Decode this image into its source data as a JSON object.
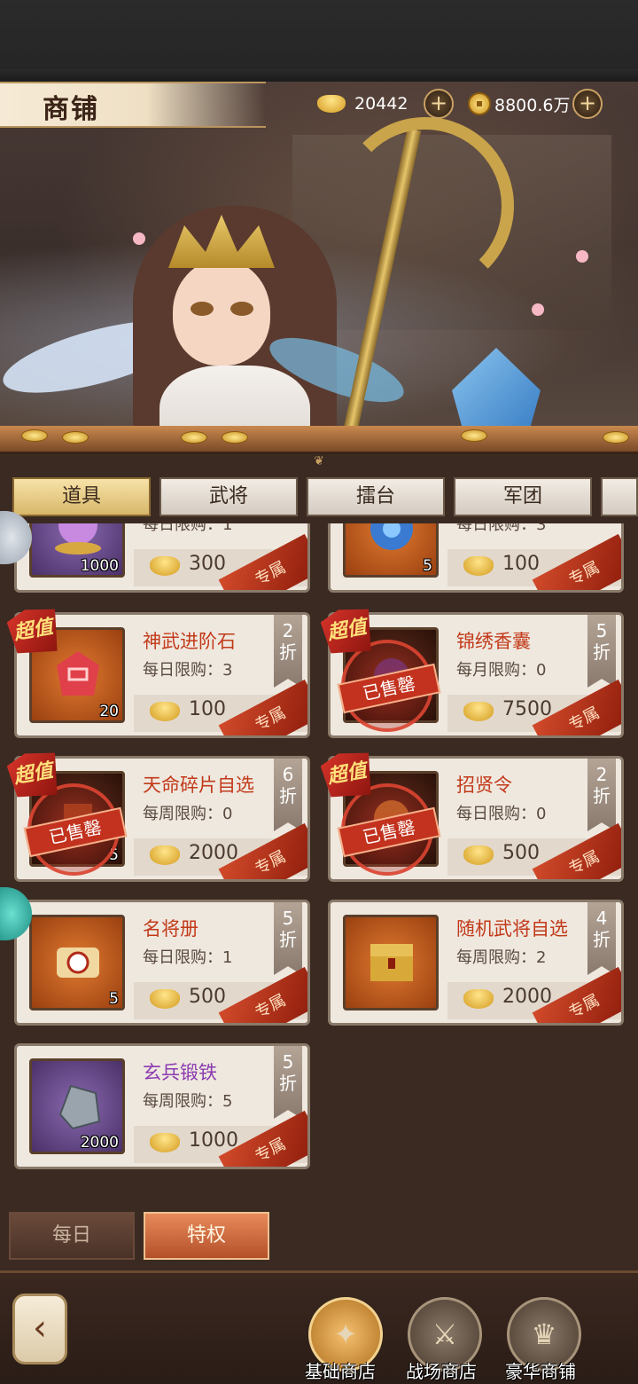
{
  "header": {
    "title": "商铺",
    "ingot_amount": "20442",
    "coin_amount": "8800.6万"
  },
  "tabs": [
    "道具",
    "武将",
    "擂台",
    "军团"
  ],
  "cards_partial": [
    {
      "qty": "1000",
      "limit": "每日限购：1",
      "price": "300",
      "exclusive": "专属"
    },
    {
      "qty": "5",
      "limit": "每日限购：3",
      "price": "100",
      "exclusive": "专属"
    }
  ],
  "cards": [
    {
      "name": "神武进阶石",
      "limit": "每日限购：3",
      "price": "100",
      "discount": "2折",
      "qty": "20",
      "super": "超值",
      "sold": "",
      "exclusive": "专属"
    },
    {
      "name": "锦绣香囊",
      "limit": "每月限购：0",
      "price": "7500",
      "discount": "5折",
      "qty": "",
      "super": "超值",
      "sold": "已售罄",
      "exclusive": "专属"
    },
    {
      "name": "天命碎片自选",
      "limit": "每周限购：0",
      "price": "2000",
      "discount": "6折",
      "qty": "5",
      "super": "超值",
      "sold": "已售罄",
      "exclusive": "专属"
    },
    {
      "name": "招贤令",
      "limit": "每日限购：0",
      "price": "500",
      "discount": "2折",
      "qty": "",
      "super": "超值",
      "sold": "已售罄",
      "exclusive": "专属"
    },
    {
      "name": "名将册",
      "limit": "每日限购：1",
      "price": "500",
      "discount": "5折",
      "qty": "5",
      "super": "",
      "sold": "",
      "exclusive": "专属"
    },
    {
      "name": "随机武将自选",
      "limit": "每周限购：2",
      "price": "2000",
      "discount": "4折",
      "qty": "",
      "super": "",
      "sold": "",
      "exclusive": "专属"
    },
    {
      "name": "玄兵锻铁",
      "limit": "每周限购：5",
      "price": "1000",
      "discount": "5折",
      "qty": "2000",
      "super": "",
      "sold": "",
      "exclusive": "专属"
    }
  ],
  "subtabs": {
    "daily": "每日",
    "privilege": "特权"
  },
  "footer": {
    "back_icon": "back-arrow-icon",
    "shops": [
      "基础商店",
      "战场商店",
      "豪华商铺"
    ]
  },
  "colors": {
    "accent_red": "#c23a1a",
    "gold": "#d39a1e",
    "purple_name": "#8a3ab0"
  }
}
